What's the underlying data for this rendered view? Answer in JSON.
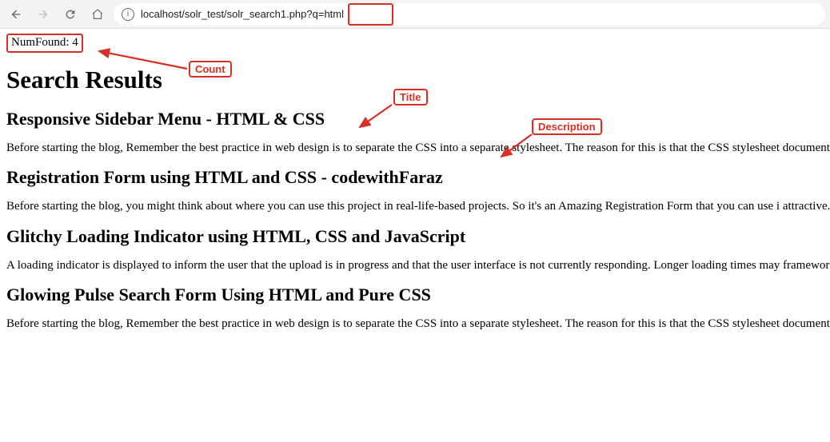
{
  "browser": {
    "url_prefix": "localhost/solr_test/solr_search1.php?q=",
    "url_query": "html"
  },
  "numfound_label": "NumFound: ",
  "numfound_value": "4",
  "heading": "Search Results",
  "results": [
    {
      "title": "Responsive Sidebar Menu - HTML & CSS",
      "desc": "Before starting the blog, Remember the best practice in web design is to separate the CSS into a separate stylesheet. The reason for this is that the CSS stylesheet document. The HTML file exists to define the structure and content of the document. And perhaps you may have JavaScript files that exist to add additional beha"
    },
    {
      "title": "Registration Form using HTML and CSS - codewithFaraz",
      "desc": "Before starting the blog, you might think about where you can use this project in real-life-based projects. So it's an Amazing Registration Form that you can use i attractive. Let's start making these amazing Registration Form Using HTML & CSS step by step."
    },
    {
      "title": "Glitchy Loading Indicator using HTML, CSS and JavaScript",
      "desc": "A loading indicator is displayed to inform the user that the upload is in progress and that the user interface is not currently responding. Longer loading times may framework automatically shows a loading indicator after a configurable delay when a server request begins and hides it after the response has finished processing"
    },
    {
      "title": "Glowing Pulse Search Form Using HTML and Pure CSS",
      "desc": "Before starting the blog, Remember the best practice in web design is to separate the CSS into a separate stylesheet. The reason for this is that the CSS stylesheet document. The HTML file exists to define the structure and content of the document. And perhaps you may have JavaScript files that exist to add additional beha"
    }
  ],
  "annotations": {
    "count": "Count",
    "title": "Title",
    "description": "Description"
  }
}
